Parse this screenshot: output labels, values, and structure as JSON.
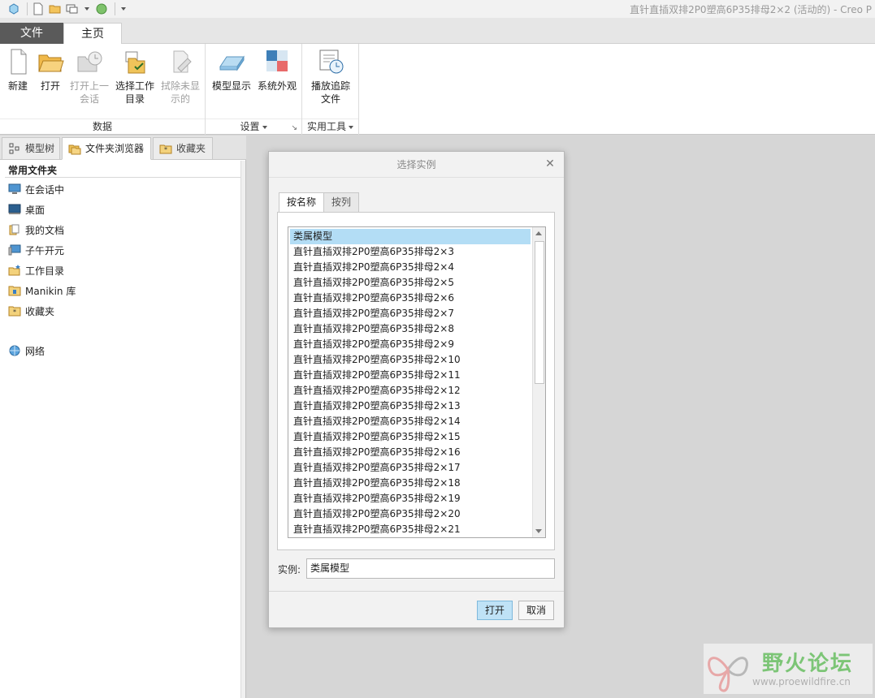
{
  "window": {
    "title": "直针直插双排2P0塑高6P35排母2×2 (活动的) - Creo P"
  },
  "quick_access": {
    "icons": [
      "cube-icon",
      "new-file-icon",
      "open-folder-icon",
      "window-icon",
      "regenerate-icon",
      "customize-icon"
    ]
  },
  "tabs": {
    "file": "文件",
    "home": "主页"
  },
  "ribbon": {
    "groups": {
      "data": "数据",
      "settings": "设置",
      "utilities": "实用工具"
    },
    "buttons": {
      "new": "新建",
      "open": "打开",
      "open_last_l1": "打开上一",
      "open_last_l2": "会话",
      "select_dir_l1": "选择工作",
      "select_dir_l2": "目录",
      "erase_l1": "拭除未显",
      "erase_l2": "示的",
      "model_display": "模型显示",
      "system_appearance": "系统外观",
      "playback_l1": "播放追踪",
      "playback_l2": "文件"
    }
  },
  "left_panel": {
    "tabs": [
      "模型树",
      "文件夹浏览器",
      "收藏夹"
    ],
    "section_title": "常用文件夹",
    "items": [
      "在会话中",
      "桌面",
      "我的文档",
      "子午开元",
      "工作目录",
      "Manikin 库",
      "收藏夹",
      "网络"
    ]
  },
  "dialog": {
    "title": "选择实例",
    "tabs": [
      "按名称",
      "按列"
    ],
    "list": [
      "类属模型",
      "直针直插双排2P0塑高6P35排母2×3",
      "直针直插双排2P0塑高6P35排母2×4",
      "直针直插双排2P0塑高6P35排母2×5",
      "直针直插双排2P0塑高6P35排母2×6",
      "直针直插双排2P0塑高6P35排母2×7",
      "直针直插双排2P0塑高6P35排母2×8",
      "直针直插双排2P0塑高6P35排母2×9",
      "直针直插双排2P0塑高6P35排母2×10",
      "直针直插双排2P0塑高6P35排母2×11",
      "直针直插双排2P0塑高6P35排母2×12",
      "直针直插双排2P0塑高6P35排母2×13",
      "直针直插双排2P0塑高6P35排母2×14",
      "直针直插双排2P0塑高6P35排母2×15",
      "直针直插双排2P0塑高6P35排母2×16",
      "直针直插双排2P0塑高6P35排母2×17",
      "直针直插双排2P0塑高6P35排母2×18",
      "直针直插双排2P0塑高6P35排母2×19",
      "直针直插双排2P0塑高6P35排母2×20",
      "直针直插双排2P0塑高6P35排母2×21"
    ],
    "selected_index": 0,
    "instance_label": "实例:",
    "instance_value": "类属模型",
    "open_button": "打开",
    "cancel_button": "取消"
  },
  "watermark": {
    "text": "野火论坛",
    "url": "www.proewildfire.cn"
  },
  "colors": {
    "selection": "#b3ddf5",
    "file_tab": "#5a5a5a",
    "primary_button": "#bfe2f6"
  }
}
